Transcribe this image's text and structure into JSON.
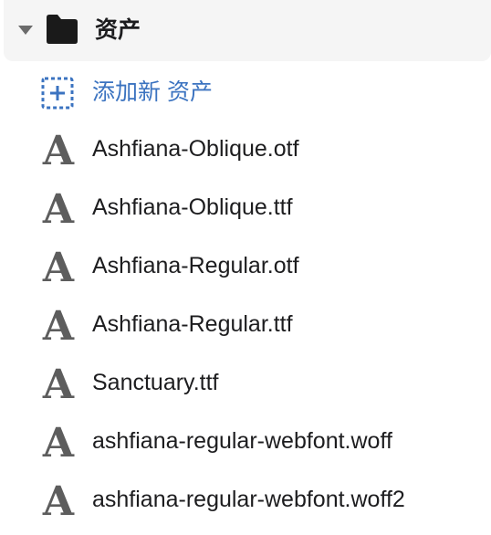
{
  "folder": {
    "label": "资产",
    "expanded": true,
    "toggle_icon": "caret-down-icon",
    "icon": "folder-icon",
    "icon_color": "#1a1a1a"
  },
  "add_asset": {
    "label": "添加新 资产",
    "icon": "add-box-icon",
    "color": "#3b73c0"
  },
  "files": [
    {
      "name": "Ashfiana-Oblique.otf",
      "icon": "font-file-icon",
      "glyph": "A"
    },
    {
      "name": "Ashfiana-Oblique.ttf",
      "icon": "font-file-icon",
      "glyph": "A"
    },
    {
      "name": "Ashfiana-Regular.otf",
      "icon": "font-file-icon",
      "glyph": "A"
    },
    {
      "name": "Ashfiana-Regular.ttf",
      "icon": "font-file-icon",
      "glyph": "A"
    },
    {
      "name": "Sanctuary.ttf",
      "icon": "font-file-icon",
      "glyph": "A"
    },
    {
      "name": "ashfiana-regular-webfont.woff",
      "icon": "font-file-icon",
      "glyph": "A"
    },
    {
      "name": "ashfiana-regular-webfont.woff2",
      "icon": "font-file-icon",
      "glyph": "A"
    }
  ]
}
